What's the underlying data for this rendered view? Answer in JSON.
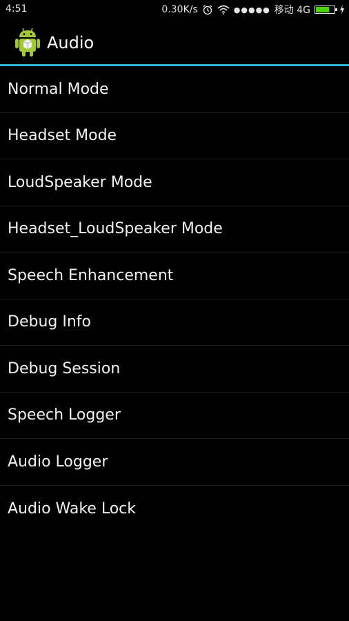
{
  "status_bar": {
    "time": "4:51",
    "network_speed": "0.30K/s",
    "carrier": "移动 4G",
    "signal": "●●●●●",
    "icons": [
      "alarm-icon",
      "wifi-icon",
      "battery-icon",
      "charging-icon"
    ],
    "battery_level": 0.75,
    "battery_color": "#4cd400"
  },
  "app_bar": {
    "title": "Audio",
    "icon": "android-icon",
    "accent_color": "#33b5e5"
  },
  "menu": {
    "items": [
      {
        "label": "Normal Mode"
      },
      {
        "label": "Headset Mode"
      },
      {
        "label": "LoudSpeaker Mode"
      },
      {
        "label": "Headset_LoudSpeaker Mode"
      },
      {
        "label": "Speech Enhancement"
      },
      {
        "label": "Debug Info"
      },
      {
        "label": "Debug Session"
      },
      {
        "label": "Speech Logger"
      },
      {
        "label": "Audio Logger"
      },
      {
        "label": "Audio Wake Lock"
      }
    ]
  }
}
